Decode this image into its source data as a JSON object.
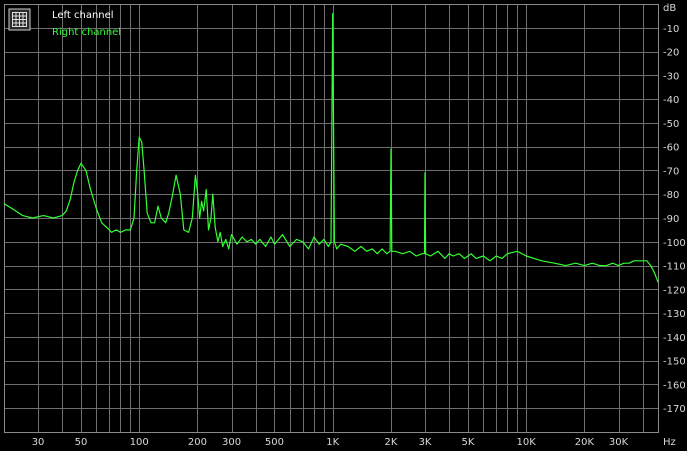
{
  "chart_data": {
    "type": "line",
    "title": "",
    "xlabel": "",
    "ylabel": "",
    "x_unit": "Hz",
    "y_unit": "dB",
    "x_scale": "log",
    "xlim": [
      20,
      48000
    ],
    "ylim": [
      -180,
      0
    ],
    "grid": true,
    "legend_position": "top-left",
    "x_ticks": [
      {
        "value": 30,
        "label": "30"
      },
      {
        "value": 50,
        "label": "50"
      },
      {
        "value": 100,
        "label": "100"
      },
      {
        "value": 200,
        "label": "200"
      },
      {
        "value": 300,
        "label": "300"
      },
      {
        "value": 500,
        "label": "500"
      },
      {
        "value": 1000,
        "label": "1K"
      },
      {
        "value": 2000,
        "label": "2K"
      },
      {
        "value": 3000,
        "label": "3K"
      },
      {
        "value": 5000,
        "label": "5K"
      },
      {
        "value": 10000,
        "label": "10K"
      },
      {
        "value": 20000,
        "label": "20K"
      },
      {
        "value": 30000,
        "label": "30K"
      }
    ],
    "y_ticks": [
      {
        "value": -10,
        "label": "-10"
      },
      {
        "value": -20,
        "label": "-20"
      },
      {
        "value": -30,
        "label": "-30"
      },
      {
        "value": -40,
        "label": "-40"
      },
      {
        "value": -50,
        "label": "-50"
      },
      {
        "value": -60,
        "label": "-60"
      },
      {
        "value": -70,
        "label": "-70"
      },
      {
        "value": -80,
        "label": "-80"
      },
      {
        "value": -90,
        "label": "-90"
      },
      {
        "value": -100,
        "label": "-100"
      },
      {
        "value": -110,
        "label": "-110"
      },
      {
        "value": -120,
        "label": "-120"
      },
      {
        "value": -130,
        "label": "-130"
      },
      {
        "value": -140,
        "label": "-140"
      },
      {
        "value": -150,
        "label": "-150"
      },
      {
        "value": -160,
        "label": "-160"
      },
      {
        "value": -170,
        "label": "-170"
      }
    ],
    "series": [
      {
        "name": "Left channel",
        "color": "#ffffff",
        "x": [],
        "y": []
      },
      {
        "name": "Right channel",
        "color": "#33ff33",
        "x": [
          20,
          22,
          25,
          28,
          32,
          36,
          40,
          42,
          44,
          46,
          48,
          50,
          53,
          56,
          60,
          64,
          68,
          72,
          76,
          80,
          85,
          90,
          94,
          97,
          100,
          103,
          106,
          110,
          115,
          120,
          125,
          130,
          137,
          142,
          148,
          155,
          163,
          170,
          180,
          188,
          195,
          200,
          205,
          210,
          215,
          222,
          228,
          235,
          240,
          247,
          255,
          262,
          270,
          280,
          290,
          300,
          320,
          340,
          360,
          380,
          400,
          420,
          450,
          480,
          500,
          550,
          600,
          650,
          700,
          750,
          800,
          850,
          900,
          950,
          980,
          1000,
          1020,
          1050,
          1100,
          1200,
          1300,
          1400,
          1500,
          1600,
          1700,
          1800,
          1900,
          1980,
          2000,
          2020,
          2100,
          2300,
          2500,
          2700,
          2900,
          2980,
          3000,
          3020,
          3200,
          3500,
          3800,
          4000,
          4200,
          4500,
          4800,
          5000,
          5200,
          5500,
          6000,
          6500,
          7000,
          7500,
          8000,
          9000,
          10000,
          11000,
          12000,
          14000,
          16000,
          18000,
          20000,
          22000,
          24000,
          26000,
          28000,
          30000,
          32000,
          34000,
          36000,
          38000,
          40000,
          42000,
          44000,
          46000,
          48000
        ],
        "y": [
          -84,
          -86,
          -89,
          -90,
          -89,
          -90,
          -89,
          -87,
          -82,
          -75,
          -70,
          -67,
          -70,
          -78,
          -86,
          -92,
          -94,
          -96,
          -95,
          -96,
          -95,
          -95,
          -90,
          -70,
          -56,
          -58,
          -70,
          -88,
          -92,
          -92,
          -85,
          -90,
          -92,
          -88,
          -81,
          -72,
          -80,
          -95,
          -96,
          -90,
          -72,
          -79,
          -90,
          -83,
          -87,
          -78,
          -95,
          -90,
          -80,
          -94,
          -100,
          -96,
          -102,
          -99,
          -103,
          -97,
          -101,
          -98,
          -100,
          -99,
          -101,
          -99,
          -102,
          -98,
          -101,
          -97,
          -102,
          -99,
          -100,
          -103,
          -98,
          -101,
          -99,
          -102,
          -100,
          -4,
          -100,
          -103,
          -101,
          -102,
          -104,
          -102,
          -104,
          -103,
          -105,
          -103,
          -105,
          -104,
          -61,
          -104,
          -104,
          -105,
          -104,
          -106,
          -105,
          -105,
          -71,
          -105,
          -106,
          -104,
          -107,
          -105,
          -106,
          -105,
          -107,
          -106,
          -105,
          -107,
          -106,
          -108,
          -106,
          -107,
          -105,
          -104,
          -106,
          -107,
          -108,
          -109,
          -110,
          -109,
          -110,
          -109,
          -110,
          -110,
          -109,
          -110,
          -109,
          -109,
          -108,
          -108,
          -108,
          -108,
          -110,
          -113,
          -117
        ]
      }
    ]
  }
}
